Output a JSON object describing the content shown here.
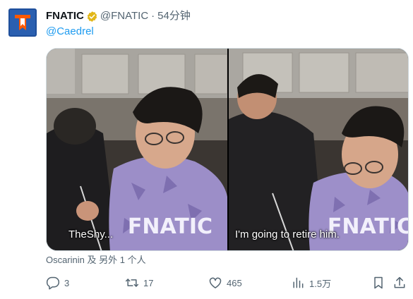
{
  "tweet": {
    "display_name": "FNATIC",
    "handle": "@FNATIC",
    "separator": "·",
    "time": "54分钟",
    "reply_to": "@Caedrel"
  },
  "avatar": {
    "brand_color": "#ff5900",
    "background": "#1f4f9b"
  },
  "media": {
    "left_caption": "TheShy...",
    "right_caption": "I'm going to retire him.",
    "shirt_text": "FNATIC"
  },
  "liked_by": "Oscarinin 及 另外 1 个人",
  "actions": {
    "reply_count": "3",
    "repost_count": "17",
    "like_count": "465",
    "view_count": "1.5万"
  },
  "colors": {
    "verified": "#e2b719",
    "link": "#1d9bf0",
    "muted": "#536471"
  }
}
